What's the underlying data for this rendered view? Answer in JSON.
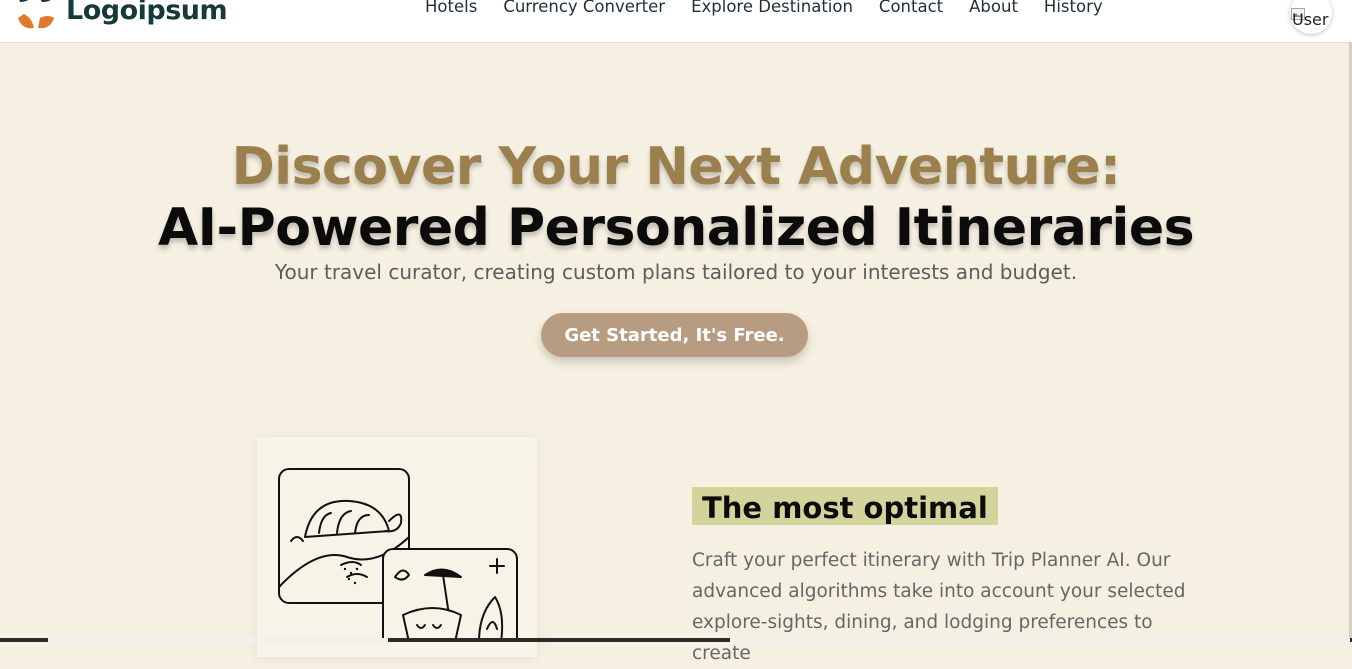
{
  "header": {
    "logo_text": "Logoipsum",
    "nav": [
      "Hotels",
      "Currency Converter",
      "Explore Destination",
      "Contact",
      "About",
      "History"
    ],
    "user_alt": "User"
  },
  "hero": {
    "title_line1": "Discover Your Next Adventure:",
    "title_line2": "AI-Powered Personalized Itineraries",
    "subtitle": "Your travel curator, creating custom plans tailored to your interests and budget.",
    "cta_label": "Get Started, It's Free."
  },
  "feature": {
    "title": "The most optimal",
    "text": "Craft your perfect itinerary with Trip Planner AI. Our advanced algorithms take into account your selected explore-sights, dining, and lodging preferences to create"
  },
  "colors": {
    "background": "#f5f0e1",
    "accent_gold": "#9b7f4d",
    "button": "#b79c81",
    "highlight": "#d3d49c",
    "logo_dark": "#163a3a",
    "logo_orange": "#e0792e"
  },
  "icons": {
    "logo": "logo-mark-icon",
    "user": "user-avatar-icon",
    "illustration": "travel-illustration-icon"
  }
}
